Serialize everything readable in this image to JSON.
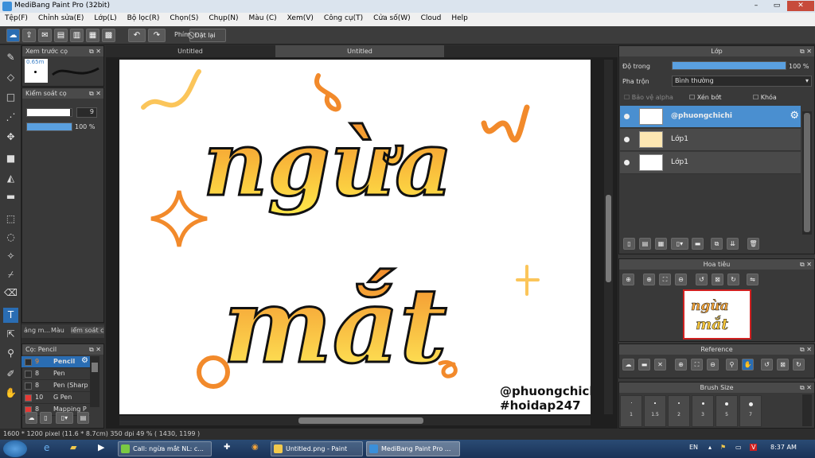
{
  "window": {
    "title": "MediBang Paint Pro (32bit)",
    "controls": [
      "–",
      "▭",
      "✕"
    ]
  },
  "menu": [
    "Tệp(F)",
    "Chỉnh sửa(E)",
    "Lớp(L)",
    "Bộ lọc(R)",
    "Chọn(S)",
    "Chụp(N)",
    "Màu (C)",
    "Xem(V)",
    "Công cụ(T)",
    "Cửa số(W)",
    "Cloud",
    "Help"
  ],
  "toolbar": {
    "label": "Phím",
    "reset": "Đặt lại"
  },
  "panels": {
    "brush_preview": {
      "title": "Xem trước cọ",
      "size": "0.65m"
    },
    "brush_control": {
      "title": "Kiểm soát cọ",
      "size_value": "9",
      "opacity": "100 %",
      "size_fraction": 0.97,
      "opacity_fraction": 1.0
    },
    "left_tabs": [
      "ảng m...",
      "Màu",
      "iểm soát c"
    ],
    "brush_list": {
      "title": "Cọ: Pencil",
      "items": [
        {
          "size": "9",
          "name": "Pencil",
          "color": "#2d2d2d",
          "selected": true
        },
        {
          "size": "8",
          "name": "Pen",
          "color": "#2d2d2d",
          "selected": false
        },
        {
          "size": "8",
          "name": "Pen (Sharp",
          "color": "#2d2d2d",
          "selected": false
        },
        {
          "size": "10",
          "name": "G Pen",
          "color": "#e53935",
          "selected": false
        },
        {
          "size": "8",
          "name": "Mapping P",
          "color": "#e53935",
          "selected": false
        }
      ]
    }
  },
  "canvas": {
    "tabs": [
      "Untitled",
      "Untitled"
    ],
    "texts": {
      "line1": "ngừa",
      "line2": "mắt",
      "handle": "@phuongchichi",
      "hashtag": "#hoidap247"
    },
    "colors": {
      "orange": "#f28a2b",
      "yellow": "#ffe94a",
      "stroke": "#111111"
    }
  },
  "layers_panel": {
    "title": "Lớp",
    "opacity_label": "Độ trong",
    "opacity_value": "100 %",
    "blend_label": "Pha trộn",
    "blend_value": "Bình thường",
    "checks": [
      "Bảo vệ alpha",
      "Xén bớt",
      "Khóa"
    ],
    "layers": [
      {
        "name": "@phuongchichi",
        "selected": true
      },
      {
        "name": "Lớp1",
        "selected": false
      },
      {
        "name": "Lớp1",
        "selected": false
      }
    ]
  },
  "navigator": {
    "title": "Hoa tiêu"
  },
  "reference": {
    "title": "Reference"
  },
  "brush_size": {
    "title": "Brush Size",
    "sizes": [
      "1",
      "1.5",
      "2",
      "3",
      "5",
      "7"
    ]
  },
  "status": {
    "text": "1600 * 1200 pixel  (11.6 * 8.7cm)  350 dpi  49 %  ( 1430, 1199 )"
  },
  "taskbar": {
    "tasks": [
      {
        "label": "Call: ngừa mắt NL: c...",
        "color": "#7ac943"
      },
      {
        "label": "Untitled.png - Paint",
        "color": "#f2c94c"
      },
      {
        "label": "MediBang Paint Pro ...",
        "color": "#3b8fd9"
      }
    ],
    "language": "EN",
    "time": "8:37 AM"
  }
}
